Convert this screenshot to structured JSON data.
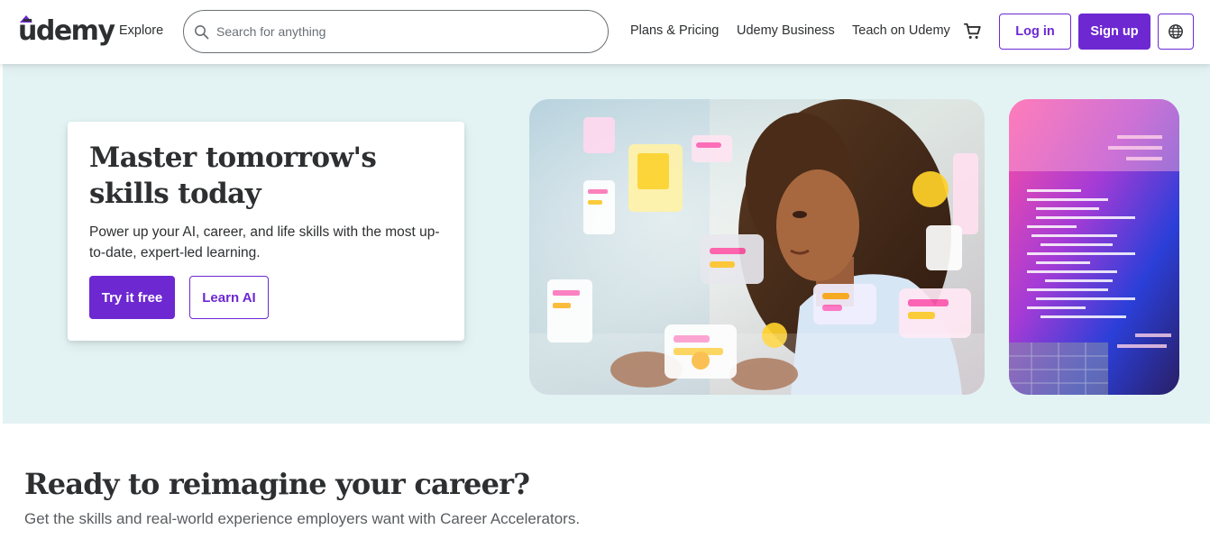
{
  "header": {
    "logo_text": "ūdemy",
    "explore_label": "Explore",
    "search_placeholder": "Search for anything",
    "search_value": "",
    "nav": [
      "Plans & Pricing",
      "Udemy Business",
      "Teach on Udemy"
    ],
    "login_label": "Log in",
    "signup_label": "Sign up",
    "icons": [
      "search-icon",
      "cart-icon",
      "globe-icon"
    ]
  },
  "hero": {
    "title": "Master tomorrow's skills today",
    "subtitle": "Power up your AI, career, and life skills with the most up-to-date, expert-led learning.",
    "primary_cta": "Try it free",
    "secondary_cta": "Learn AI"
  },
  "section": {
    "title": "Ready to reimagine your career?",
    "subtitle": "Get the skills and real-world experience employers want with Career Accelerators."
  },
  "colors": {
    "brand": "#6d28d2",
    "hero_bg": "#e3f3f4",
    "text": "#2d2f31",
    "muted": "#595c5f"
  }
}
